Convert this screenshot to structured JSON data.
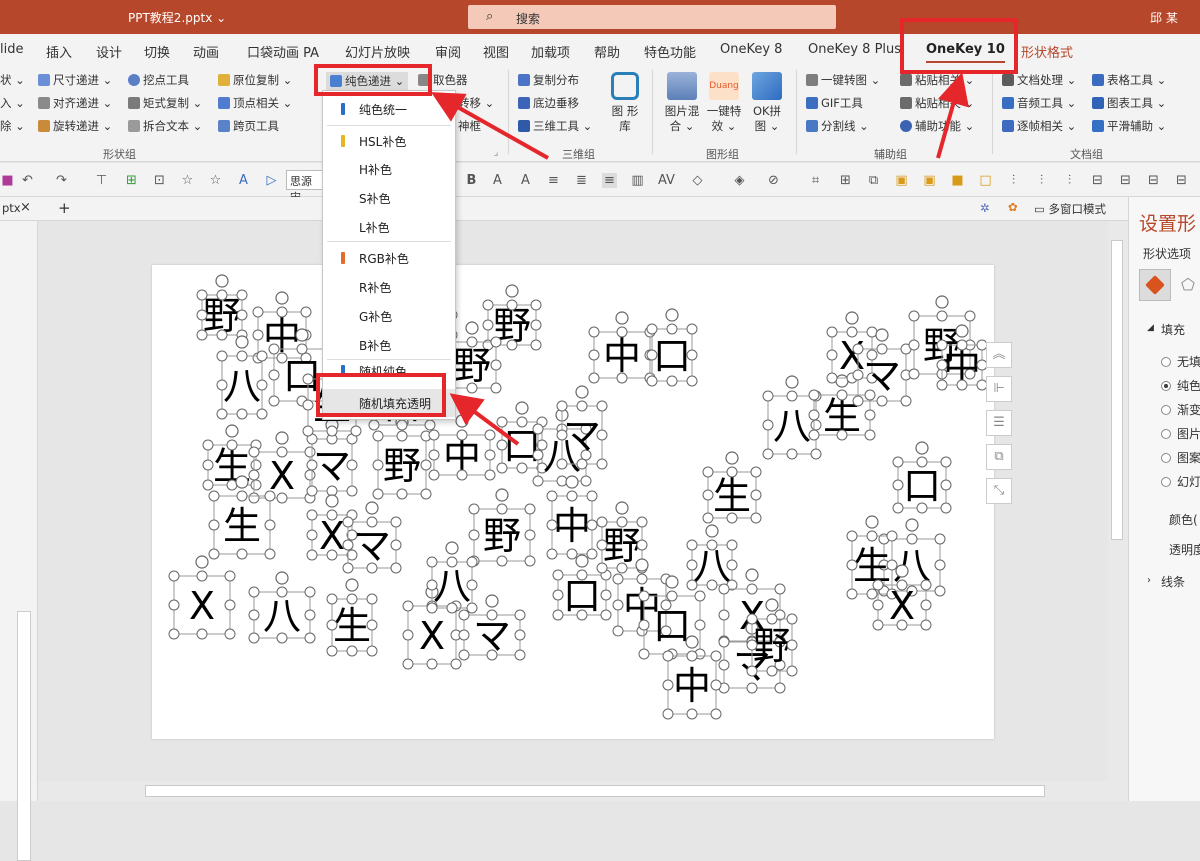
{
  "window": {
    "file_name": "PPT教程2.pptx ⌄",
    "search_placeholder": "搜索",
    "user": "邱 某"
  },
  "menu_tabs": [
    {
      "label": "lide"
    },
    {
      "label": "插入"
    },
    {
      "label": "设计"
    },
    {
      "label": "切换"
    },
    {
      "label": "动画"
    },
    {
      "label": "口袋动画 PA"
    },
    {
      "label": "幻灯片放映"
    },
    {
      "label": "审阅"
    },
    {
      "label": "视图"
    },
    {
      "label": "加载项"
    },
    {
      "label": "帮助"
    },
    {
      "label": "特色功能"
    },
    {
      "label": "OneKey 8"
    },
    {
      "label": "OneKey 8 Plus"
    },
    {
      "label": "OneKey 10"
    },
    {
      "label": "形状格式"
    }
  ],
  "ribbon": {
    "shape_group": {
      "col0": [
        "状 ⌄",
        "入 ⌄",
        "除 ⌄"
      ],
      "col1": [
        "尺寸递进 ⌄",
        "对齐递进 ⌄",
        "旋转递进 ⌄"
      ],
      "col2": [
        "挖点工具",
        "矩式复制 ⌄",
        "拆合文本 ⌄"
      ],
      "col3": [
        "原位复制 ⌄",
        "顶点相关 ⌄",
        "跨页工具"
      ],
      "solid_color_btn": "纯色递进 ⌄",
      "color_picker": "取色器",
      "hidden_tail": [
        "转移 ⌄",
        "神框"
      ],
      "label": "形状组"
    },
    "three_d_group": {
      "items": [
        "复制分布",
        "底边垂移",
        "三维工具 ⌄"
      ],
      "big": "图 形库",
      "label": "三维组"
    },
    "graphic_group": {
      "big1": "图片混 合 ⌄",
      "big2": "一键特 效 ⌄",
      "big3": "OK拼 图 ⌄",
      "label": "图形组"
    },
    "aux_group": {
      "col1": [
        "一键转图 ⌄",
        "GIF工具",
        "分割线 ⌄"
      ],
      "col2": [
        "粘贴相关 ⌄",
        "粘贴相关 ⌄",
        "辅助功能 ⌄"
      ],
      "label": "辅助组"
    },
    "doc_group": {
      "col1": [
        "文档处理 ⌄",
        "音频工具 ⌄",
        "逐帧相关 ⌄"
      ],
      "col2": [
        "表格工具 ⌄",
        "图表工具 ⌄",
        "平滑辅助 ⌄"
      ],
      "label": "文档组"
    }
  },
  "qat": {
    "font_name": "思源宋"
  },
  "doc_tab": {
    "label": "ptx",
    "close": "×",
    "add": "+"
  },
  "multiwindow": "多窗口模式",
  "dropdown": {
    "items": [
      {
        "label": "纯色统一",
        "color": "#2b6cc9"
      },
      {
        "label": "HSL补色",
        "color": "#e7b422"
      },
      {
        "label": "H补色",
        "color": ""
      },
      {
        "label": "S补色",
        "color": ""
      },
      {
        "label": "L补色",
        "color": ""
      },
      {
        "label": "RGB补色",
        "color": "#e46c2b"
      },
      {
        "label": "R补色",
        "color": ""
      },
      {
        "label": "G补色",
        "color": ""
      },
      {
        "label": "B补色",
        "color": ""
      },
      {
        "label": "随机纯色",
        "color": "#2b6cc9"
      },
      {
        "label": "随机填充透明",
        "color": ""
      }
    ]
  },
  "right_panel": {
    "title": "设置形",
    "tab": "形状选项",
    "section": "填充",
    "options": [
      "无填",
      "纯色",
      "渐变",
      "图片",
      "图案",
      "幻灯"
    ],
    "selected_option": "纯色",
    "color_label": "颜色(",
    "transparency_label": "透明度",
    "line_label": "线条"
  },
  "slide_chars": [
    "野",
    "中",
    "口",
    "八",
    "生",
    "X",
    "マ",
    "野",
    "中",
    "口",
    "八",
    "生",
    "X",
    "マ"
  ],
  "colors": {
    "accent": "#b7472a",
    "highlight_red": "#e5262b",
    "ribbon_bg": "#f3f3f3"
  }
}
